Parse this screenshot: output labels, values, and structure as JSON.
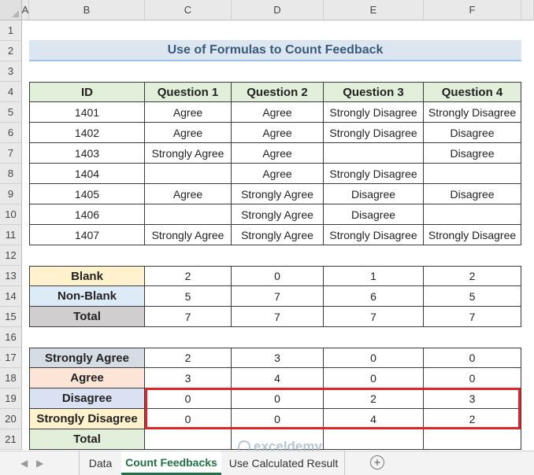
{
  "sheet": {
    "columns": [
      "A",
      "B",
      "C",
      "D",
      "E",
      "F"
    ],
    "rows": [
      "1",
      "2",
      "3",
      "4",
      "5",
      "6",
      "7",
      "8",
      "9",
      "10",
      "11",
      "12",
      "13",
      "14",
      "15",
      "16",
      "17",
      "18",
      "19",
      "20",
      "21"
    ],
    "title": "Use of Formulas to Count Feedback",
    "main_table": {
      "headers": [
        "ID",
        "Question 1",
        "Question 2",
        "Question 3",
        "Question 4"
      ],
      "rows": [
        [
          "1401",
          "Agree",
          "Agree",
          "Strongly Disagree",
          "Strongly Disagree"
        ],
        [
          "1402",
          "Agree",
          "Agree",
          "Strongly Disagree",
          "Disagree"
        ],
        [
          "1403",
          "Strongly Agree",
          "Agree",
          "",
          "Disagree"
        ],
        [
          "1404",
          "",
          "Agree",
          "Strongly Disagree",
          ""
        ],
        [
          "1405",
          "Agree",
          "Strongly Agree",
          "Disagree",
          "Disagree"
        ],
        [
          "1406",
          "",
          "Strongly Agree",
          "Disagree",
          ""
        ],
        [
          "1407",
          "Strongly Agree",
          "Strongly Agree",
          "Strongly Disagree",
          "Strongly Disagree"
        ]
      ]
    },
    "count_table": {
      "rows": [
        {
          "label": "Blank",
          "values": [
            "2",
            "0",
            "1",
            "2"
          ]
        },
        {
          "label": "Non-Blank",
          "values": [
            "5",
            "7",
            "6",
            "5"
          ]
        },
        {
          "label": "Total",
          "values": [
            "7",
            "7",
            "7",
            "7"
          ]
        }
      ]
    },
    "feedback_table": {
      "rows": [
        {
          "label": "Strongly Agree",
          "values": [
            "2",
            "3",
            "0",
            "0"
          ]
        },
        {
          "label": "Agree",
          "values": [
            "3",
            "4",
            "0",
            "0"
          ]
        },
        {
          "label": "Disagree",
          "values": [
            "0",
            "0",
            "2",
            "3"
          ]
        },
        {
          "label": "Strongly Disagree",
          "values": [
            "0",
            "0",
            "4",
            "2"
          ]
        },
        {
          "label": "Total",
          "values": [
            "",
            "",
            "",
            ""
          ]
        }
      ]
    },
    "label_colors": {
      "blank": "#fff2cc",
      "non_blank": "#ddebf7",
      "total_gray": "#d0cece",
      "strongly_agree": "#d6dce4",
      "agree": "#fce4d6",
      "disagree": "#d9e1f2",
      "strongly_disagree": "#fff2cc",
      "total_green": "#e2efda"
    },
    "highlight_color": "#e0242b"
  },
  "watermark": {
    "text": "exceldemy"
  },
  "tabs": {
    "items": [
      "Data",
      "Count Feedbacks",
      "Use Calculated Result"
    ],
    "active": "Count Feedbacks",
    "add_icon": "plus-circle-icon",
    "nav_icons": [
      "scroll-left-icon",
      "scroll-right-icon"
    ]
  }
}
